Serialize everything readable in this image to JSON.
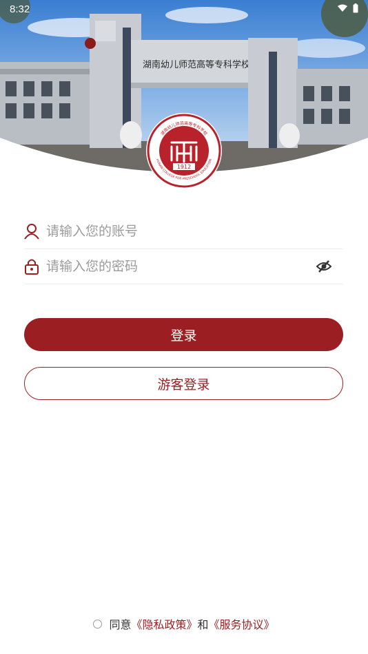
{
  "status_bar": {
    "time": "8:32"
  },
  "header": {
    "gate_sign": "湖南幼儿师范高等专科学校",
    "logo_year": "1912",
    "logo_text_top": "湖南幼儿师范高等专科学校",
    "logo_text_bottom": "HUNAN COLLEGE FOR PRESCHOOL EDUCATION"
  },
  "login": {
    "account_placeholder": "请输入您的账号",
    "password_placeholder": "请输入您的密码",
    "login_label": "登录",
    "guest_label": "游客登录"
  },
  "agreement": {
    "prefix": "同意",
    "privacy": "《隐私政策》",
    "and": "和",
    "service": "《服务协议》"
  },
  "colors": {
    "accent": "#9b1f22"
  },
  "icons": {
    "account": "user-icon",
    "password": "lock-icon",
    "visibility": "eye-off-icon"
  }
}
